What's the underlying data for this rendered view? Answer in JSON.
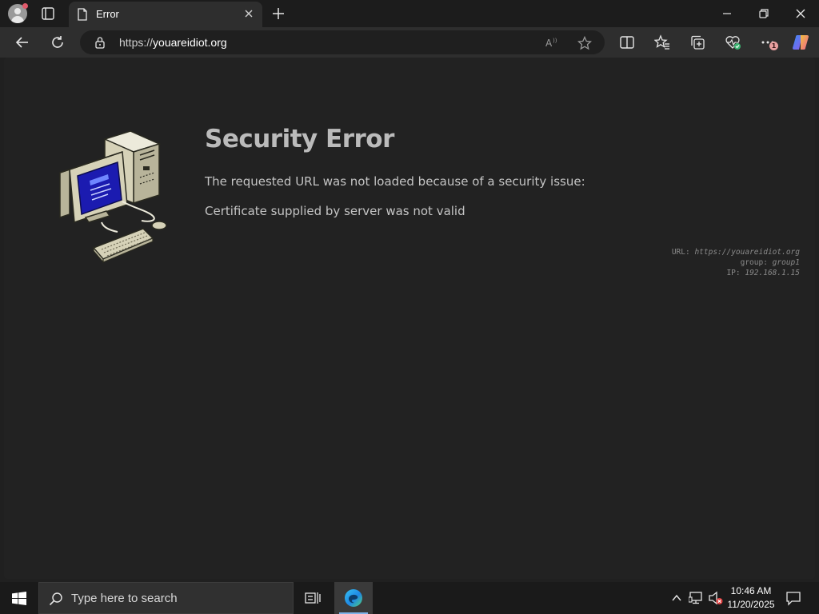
{
  "browser": {
    "tab": {
      "title": "Error"
    },
    "address": {
      "scheme": "https://",
      "host": "youareidiot.org"
    },
    "notification_badge": "1"
  },
  "page": {
    "title": "Security Error",
    "message": "The requested URL was not loaded because of a security issue:",
    "detail": "Certificate supplied by server was not valid",
    "meta": {
      "url_label": "URL:",
      "url_value": "https://youareidiot.org",
      "group_label": "group:",
      "group_value": "group1",
      "ip_label": "IP:",
      "ip_value": "192.168.1.15"
    }
  },
  "taskbar": {
    "search_placeholder": "Type here to search",
    "time": "10:46 AM",
    "date": "11/20/2025"
  },
  "colors": {
    "page_bg": "#222222",
    "title": "#bbbbbb",
    "screen_blue": "#1b1bb0",
    "computer_beige": "#d6d2b8"
  }
}
